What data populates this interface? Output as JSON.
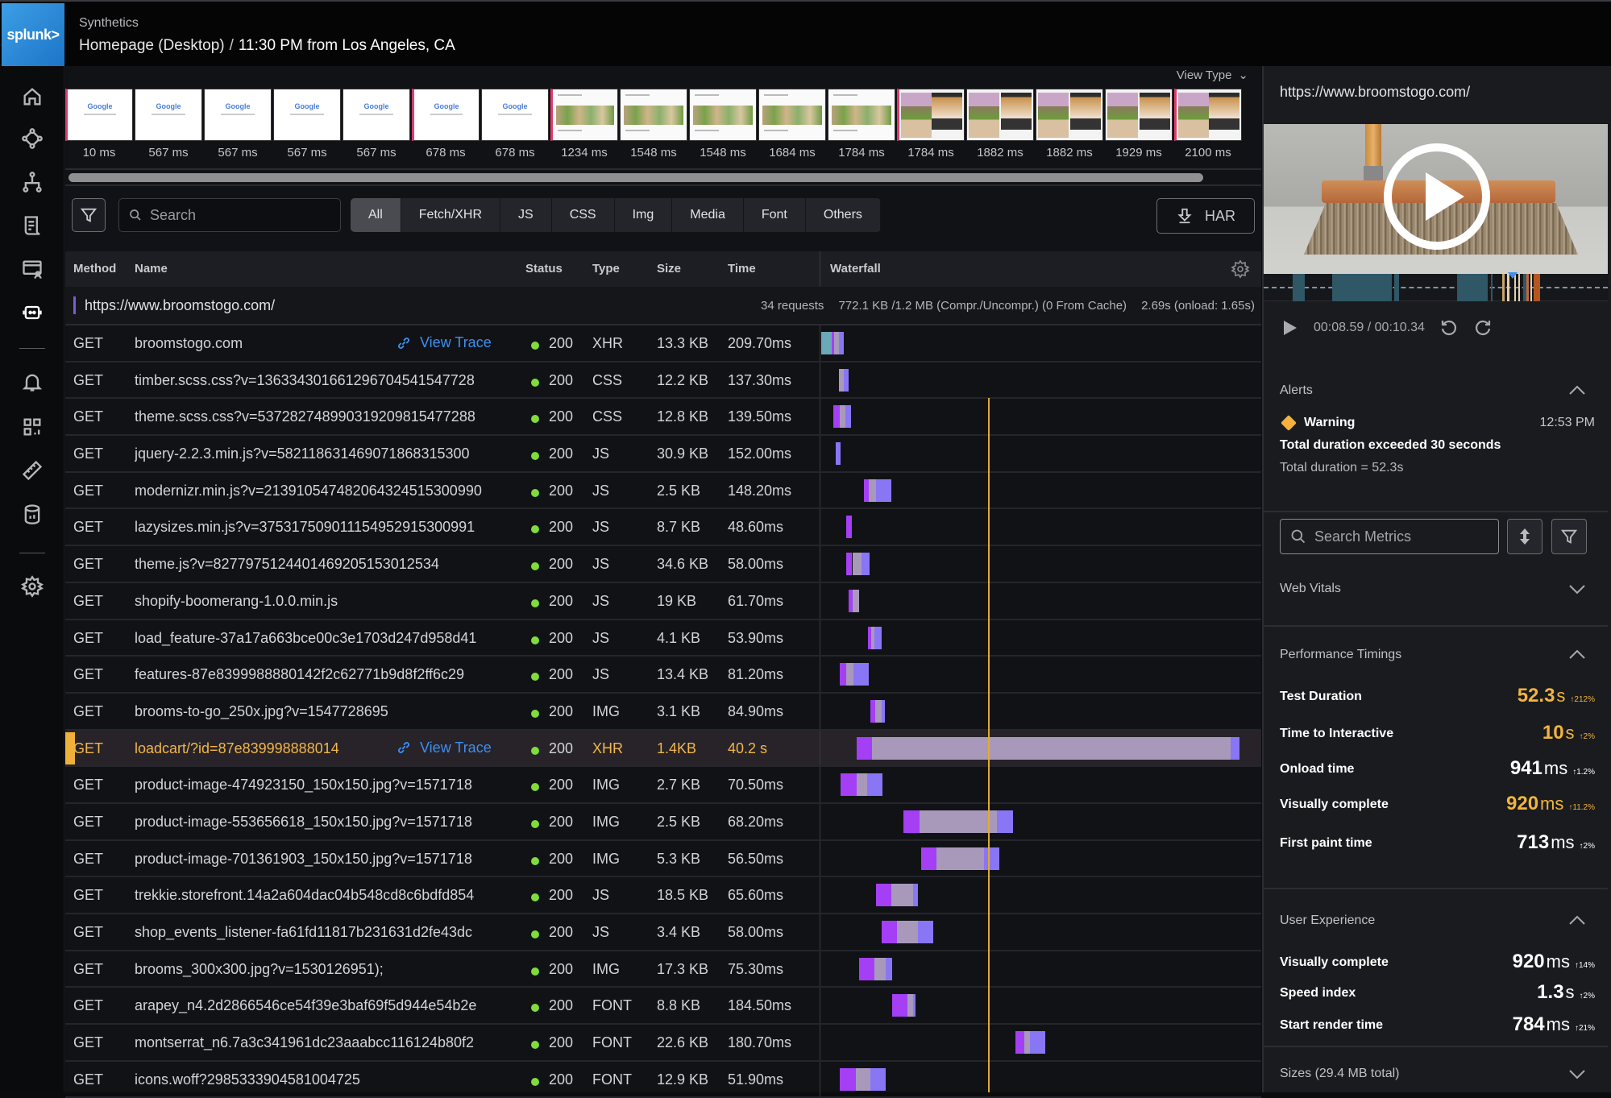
{
  "header": {
    "logo": "splunk>",
    "app": "Synthetics",
    "test_name": "Homepage (Desktop)",
    "separator": "/",
    "run": "11:30 PM from Los Angeles, CA"
  },
  "sidenav": {
    "items": [
      {
        "icon": "home-icon"
      },
      {
        "icon": "service-map-icon"
      },
      {
        "icon": "hierarchy-icon"
      },
      {
        "icon": "logs-icon"
      },
      {
        "icon": "rum-icon"
      },
      {
        "icon": "synthetics-robot-icon",
        "active": true
      },
      {
        "icon": "bell-icon"
      },
      {
        "icon": "dashboards-icon"
      },
      {
        "icon": "ruler-icon"
      },
      {
        "icon": "database-icon"
      },
      {
        "icon": "settings-icon"
      }
    ]
  },
  "filmstrip": {
    "view_type_label": "View Type",
    "frames": [
      {
        "time": "10 ms",
        "kind": "google",
        "marked": true
      },
      {
        "time": "567 ms",
        "kind": "google"
      },
      {
        "time": "567 ms",
        "kind": "google"
      },
      {
        "time": "567 ms",
        "kind": "google"
      },
      {
        "time": "567 ms",
        "kind": "google"
      },
      {
        "time": "678 ms",
        "kind": "google",
        "marked": true
      },
      {
        "time": "678 ms",
        "kind": "google"
      },
      {
        "time": "1234 ms",
        "kind": "store",
        "marked": true
      },
      {
        "time": "1548 ms",
        "kind": "store"
      },
      {
        "time": "1548 ms",
        "kind": "store"
      },
      {
        "time": "1684 ms",
        "kind": "store"
      },
      {
        "time": "1784 ms",
        "kind": "store"
      },
      {
        "time": "1784 ms",
        "kind": "pup",
        "marked": true
      },
      {
        "time": "1882 ms",
        "kind": "pup"
      },
      {
        "time": "1882 ms",
        "kind": "pup"
      },
      {
        "time": "1929 ms",
        "kind": "pup"
      },
      {
        "time": "2100 ms",
        "kind": "pup",
        "marked": true
      }
    ],
    "google_label": "Google"
  },
  "toolbar": {
    "search_placeholder": "Search",
    "tabs": [
      "All",
      "Fetch/XHR",
      "JS",
      "CSS",
      "Img",
      "Media",
      "Font",
      "Others"
    ],
    "active_tab": "All",
    "har_label": "HAR"
  },
  "table": {
    "columns": {
      "method": "Method",
      "name": "Name",
      "status": "Status",
      "type": "Type",
      "size": "Size",
      "time": "Time",
      "waterfall": "Waterfall"
    },
    "page_url": "https://www.broomstogo.com/",
    "stats": {
      "requests": "34 requests",
      "transfer": "772.1 KB /1.2 MB (Compr./Uncompr.) (0 From Cache)",
      "load": "2.69s (onload: 1.65s)"
    },
    "view_trace_label": "View Trace",
    "onload_marker_pct": 38.4,
    "colors": {
      "dns": "#6aa9b8",
      "connect": "#a43ff5",
      "wait": "#a899bb",
      "receive": "#8876f5",
      "marker": "#e3aa2f",
      "status_ok": "#7fdc3a",
      "highlight": "#f0b13a",
      "link": "#3d8ff0"
    },
    "rows": [
      {
        "method": "GET",
        "name": "broomstogo.com",
        "trace": true,
        "status": "200",
        "type": "XHR",
        "size": "13.3 KB",
        "time": "209.70ms",
        "bar": {
          "start": 0,
          "segs": [
            [
              "dns",
              2.4
            ],
            [
              "connect",
              0.6
            ],
            [
              "wait",
              1.1
            ],
            [
              "receive",
              1.1
            ]
          ]
        }
      },
      {
        "method": "GET",
        "name": "timber.scss.css?v=136334301661296704541547728",
        "status": "200",
        "type": "CSS",
        "size": "12.2 KB",
        "time": "137.30ms",
        "bar": {
          "start": 4.1,
          "segs": [
            [
              "wait",
              1.1
            ],
            [
              "receive",
              1.0
            ]
          ]
        }
      },
      {
        "method": "GET",
        "name": "theme.scss.css?v=537282748990319209815477288",
        "status": "200",
        "type": "CSS",
        "size": "12.8 KB",
        "time": "139.50ms",
        "bar": {
          "start": 2.8,
          "segs": [
            [
              "connect",
              1.5
            ],
            [
              "wait",
              1.3
            ],
            [
              "receive",
              1.3
            ]
          ]
        }
      },
      {
        "method": "GET",
        "name": "jquery-2.2.3.min.js?v=582118631469071868315300",
        "status": "200",
        "type": "JS",
        "size": "30.9 KB",
        "time": "152.00ms",
        "bar": {
          "start": 3.3,
          "segs": [
            [
              "receive",
              1.1
            ]
          ]
        }
      },
      {
        "method": "GET",
        "name": "modernizr.min.js?v=213910547482064324515300990",
        "status": "200",
        "type": "JS",
        "size": "2.5 KB",
        "time": "148.20ms",
        "bar": {
          "start": 9.7,
          "segs": [
            [
              "connect",
              1.2
            ],
            [
              "wait",
              1.6
            ],
            [
              "receive",
              3.6
            ]
          ]
        }
      },
      {
        "method": "GET",
        "name": "lazysizes.min.js?v=375317509011154952915300991",
        "status": "200",
        "type": "JS",
        "size": "8.7 KB",
        "time": "48.60ms",
        "bar": {
          "start": 5.8,
          "segs": [
            [
              "connect",
              1.3
            ]
          ]
        }
      },
      {
        "method": "GET",
        "name": "theme.js?v=8277975124401469205153012534",
        "status": "200",
        "type": "JS",
        "size": "34.6 KB",
        "time": "58.00ms",
        "bar": {
          "start": 5.8,
          "segs": [
            [
              "connect",
              1.3
            ],
            [
              "wait",
              2.2
            ],
            [
              "receive",
              1.7
            ]
          ]
        }
      },
      {
        "method": "GET",
        "name": "shopify-boomerang-1.0.0.min.js",
        "status": "200",
        "type": "JS",
        "size": "19 KB",
        "time": "61.70ms",
        "bar": {
          "start": 6.3,
          "segs": [
            [
              "connect",
              0.9
            ],
            [
              "wait",
              1.5
            ]
          ]
        }
      },
      {
        "method": "GET",
        "name": "load_feature-37a17a663bce00c3e1703d247d958d41",
        "status": "200",
        "type": "JS",
        "size": "4.1 KB",
        "time": "53.90ms",
        "bar": {
          "start": 10.7,
          "segs": [
            [
              "connect",
              0.7
            ],
            [
              "wait",
              0.7
            ],
            [
              "receive",
              1.8
            ]
          ]
        }
      },
      {
        "method": "GET",
        "name": "features-87e8399988880142f2c62771b9d8f2ff6c29",
        "status": "200",
        "type": "JS",
        "size": "13.4 KB",
        "time": "81.20ms",
        "bar": {
          "start": 4.2,
          "segs": [
            [
              "connect",
              1.5
            ],
            [
              "wait",
              1.7
            ],
            [
              "receive",
              3.5
            ]
          ]
        }
      },
      {
        "method": "GET",
        "name": "brooms-to-go_250x.jpg?v=1547728695",
        "status": "200",
        "type": "IMG",
        "size": "3.1 KB",
        "time": "84.90ms",
        "bar": {
          "start": 11.3,
          "segs": [
            [
              "connect",
              1.0
            ],
            [
              "wait",
              1.5
            ],
            [
              "receive",
              0.7
            ]
          ]
        }
      },
      {
        "method": "GET",
        "name": "loadcart/?id=87e839998888014",
        "trace": true,
        "highlight": true,
        "status": "200",
        "type": "XHR",
        "size": "1.4KB",
        "time": "40.2 s",
        "bar": {
          "start": 8.1,
          "segs": [
            [
              "connect",
              3.6
            ],
            [
              "wait",
              82.0
            ],
            [
              "receive",
              2.1
            ]
          ]
        }
      },
      {
        "method": "GET",
        "name": "product-image-474923150_150x150.jpg?v=1571718",
        "status": "200",
        "type": "IMG",
        "size": "2.7 KB",
        "time": "70.50ms",
        "bar": {
          "start": 4.4,
          "segs": [
            [
              "connect",
              3.7
            ],
            [
              "wait",
              2.4
            ],
            [
              "receive",
              3.5
            ]
          ]
        }
      },
      {
        "method": "GET",
        "name": "product-image-553656618_150x150.jpg?v=1571718",
        "status": "200",
        "type": "IMG",
        "size": "2.5 KB",
        "time": "68.20ms",
        "bar": {
          "start": 18.9,
          "segs": [
            [
              "connect",
              3.6
            ],
            [
              "wait",
              17.8
            ],
            [
              "receive",
              3.6
            ]
          ]
        }
      },
      {
        "method": "GET",
        "name": "product-image-701361903_150x150.jpg?v=1571718",
        "status": "200",
        "type": "IMG",
        "size": "5.3 KB",
        "time": "56.50ms",
        "bar": {
          "start": 22.8,
          "segs": [
            [
              "connect",
              3.6
            ],
            [
              "wait",
              10.8
            ],
            [
              "receive",
              3.5
            ]
          ]
        }
      },
      {
        "method": "GET",
        "name": "trekkie.storefront.14a2a604dac04b548cd8c6bdfd854",
        "status": "200",
        "type": "JS",
        "size": "18.5 KB",
        "time": "65.60ms",
        "bar": {
          "start": 12.5,
          "segs": [
            [
              "connect",
              3.6
            ],
            [
              "wait",
              5.0
            ],
            [
              "receive",
              1.0
            ]
          ]
        }
      },
      {
        "method": "GET",
        "name": "shop_events_listener-fa61fd11817b231631d2fe43dc",
        "status": "200",
        "type": "JS",
        "size": "3.4 KB",
        "time": "58.00ms",
        "bar": {
          "start": 13.8,
          "segs": [
            [
              "connect",
              3.6
            ],
            [
              "wait",
              4.7
            ],
            [
              "receive",
              3.6
            ]
          ]
        }
      },
      {
        "method": "GET",
        "name": "brooms_300x300.jpg?v=1530126951);",
        "status": "200",
        "type": "IMG",
        "size": "17.3 KB",
        "time": "75.30ms",
        "bar": {
          "start": 8.7,
          "segs": [
            [
              "connect",
              3.5
            ],
            [
              "wait",
              2.6
            ],
            [
              "receive",
              1.4
            ]
          ]
        }
      },
      {
        "method": "GET",
        "name": "arapey_n4.2d2866546ce54f39e3baf69f5d944e54b2e",
        "status": "200",
        "type": "FONT",
        "size": "8.8 KB",
        "time": "184.50ms",
        "bar": {
          "start": 16.2,
          "segs": [
            [
              "connect",
              3.6
            ],
            [
              "wait",
              1.2
            ],
            [
              "receive",
              0.6
            ]
          ]
        }
      },
      {
        "method": "GET",
        "name": "montserrat_n6.7a3c341961dc23aaabcc116124b80f2",
        "status": "200",
        "type": "FONT",
        "size": "22.6 KB",
        "time": "180.70ms",
        "bar": {
          "start": 44.5,
          "segs": [
            [
              "connect",
              2.0
            ],
            [
              "wait",
              1.3
            ],
            [
              "receive",
              3.5
            ]
          ]
        }
      },
      {
        "method": "GET",
        "name": "icons.woff?2985333904581004725",
        "status": "200",
        "type": "FONT",
        "size": "12.9 KB",
        "time": "51.90ms",
        "bar": {
          "start": 4.2,
          "segs": [
            [
              "connect",
              3.7
            ],
            [
              "wait",
              3.3
            ],
            [
              "receive",
              3.5
            ]
          ]
        }
      }
    ]
  },
  "right_panel": {
    "url": "https://www.broomstogo.com/",
    "video": {
      "current_time": "00:08.59",
      "separator": "/",
      "total_time": "00:10.34",
      "progress_pct": 83
    },
    "alerts": {
      "title": "Alerts",
      "severity": "Warning",
      "time": "12:53 PM",
      "message": "Total duration exceeded 30 seconds",
      "detail": "Total duration  = 52.3s"
    },
    "metrics_search_placeholder": "Search Metrics",
    "web_vitals_title": "Web Vitals",
    "performance": {
      "title": "Performance Timings",
      "items": [
        {
          "label": "Test Duration",
          "value": "52.3",
          "unit": "s",
          "delta": "↑212%",
          "warn": true
        },
        {
          "label": "Time to Interactive",
          "value": "10",
          "unit": "s",
          "delta": "↑2%",
          "warn": true
        },
        {
          "label": "Onload time",
          "value": "941",
          "unit": "ms",
          "delta": "↑1.2%"
        },
        {
          "label": "Visually complete",
          "value": "920",
          "unit": "ms",
          "delta": "↑11.2%",
          "warn": true
        },
        {
          "label": "First paint time",
          "value": "713",
          "unit": "ms",
          "delta": "↑2%"
        }
      ]
    },
    "user_experience": {
      "title": "User Experience",
      "items": [
        {
          "label": "Visually complete",
          "value": "920",
          "unit": "ms",
          "delta": "↑14%"
        },
        {
          "label": "Speed index",
          "value": "1.3",
          "unit": "s",
          "delta": "↑2%"
        },
        {
          "label": "Start render time",
          "value": "784",
          "unit": "ms",
          "delta": "↑21%"
        }
      ]
    },
    "sizes_title": "Sizes (29.4 MB total)"
  }
}
